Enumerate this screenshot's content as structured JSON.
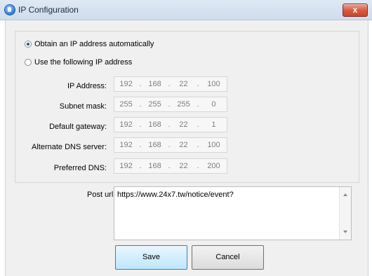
{
  "window": {
    "title": "IP Configuration",
    "close_label": "x"
  },
  "options": {
    "auto_label": "Obtain an IP address automatically",
    "manual_label": "Use the following IP address",
    "selected": "auto"
  },
  "fields": [
    {
      "label": "IP Address:",
      "octets": [
        "192",
        "168",
        "22",
        "100"
      ]
    },
    {
      "label": "Subnet mask:",
      "octets": [
        "255",
        "255",
        "255",
        "0"
      ]
    },
    {
      "label": "Default gateway:",
      "octets": [
        "192",
        "168",
        "22",
        "1"
      ]
    },
    {
      "label": "Alternate DNS server:",
      "octets": [
        "192",
        "168",
        "22",
        "100"
      ]
    },
    {
      "label": "Preferred DNS:",
      "octets": [
        "192",
        "168",
        "22",
        "200"
      ]
    }
  ],
  "post": {
    "label": "Post url:",
    "value": "https://www.24x7.tw/notice/event?"
  },
  "buttons": {
    "save": "Save",
    "cancel": "Cancel"
  },
  "colors": {
    "save_border": "#3c7fb1",
    "close_bg": "#d9573c",
    "window_bg": "#f0f0f0"
  }
}
